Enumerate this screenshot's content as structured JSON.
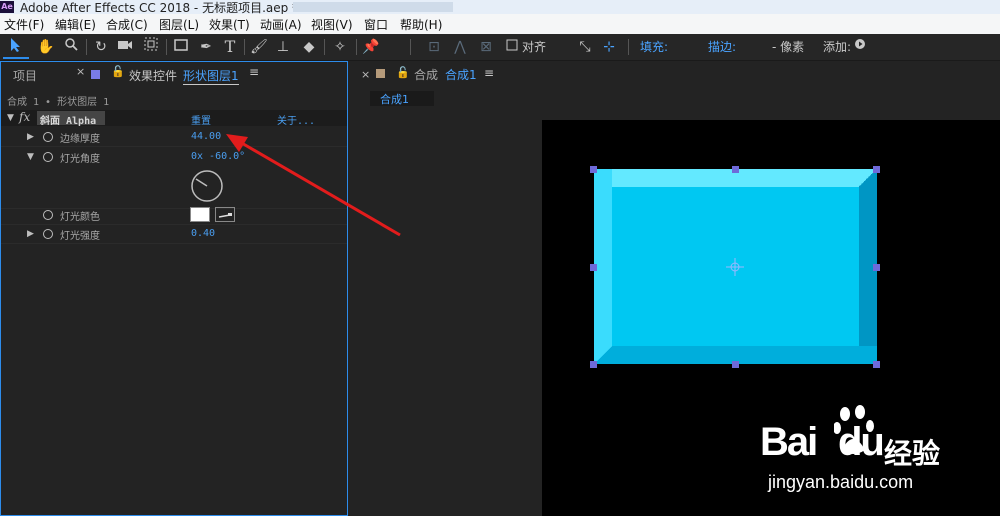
{
  "window": {
    "app_badge": "Ae",
    "title": "Adobe After Effects CC 2018 - 无标题项目.aep *"
  },
  "menu": [
    "文件(F)",
    "编辑(E)",
    "合成(C)",
    "图层(L)",
    "效果(T)",
    "动画(A)",
    "视图(V)",
    "窗口",
    "帮助(H)"
  ],
  "toolbar": {
    "align_label": "对齐",
    "fill_label": "填充:",
    "fill_color": "#00c8f2",
    "stroke_label": "描边:",
    "stroke_value": "- 像素",
    "add_label": "添加:"
  },
  "left_panel": {
    "project_tab": "项目",
    "effects_tab_prefix": "效果控件",
    "effects_tab_layer": "形状图层1",
    "breadcrumb": "合成 1 • 形状图层 1",
    "effect": {
      "fx": "fx",
      "name": "斜面 Alpha",
      "reset": "重置",
      "about": "关于...",
      "props": [
        {
          "label": "边缘厚度",
          "value": "44.00"
        },
        {
          "label": "灯光角度",
          "value": "0x -60.0°"
        },
        {
          "label": "灯光颜色",
          "value": ""
        },
        {
          "label": "灯光强度",
          "value": "0.40"
        }
      ]
    }
  },
  "right_panel": {
    "tab_prefix": "合成",
    "tab_name": "合成1",
    "sub_tab": "合成1"
  },
  "colors": {
    "accent": "#2d8ceb",
    "value_blue": "#4a9ef0",
    "shape_fill": "#00c8f2",
    "arrow_red": "#e21c1c"
  },
  "watermark": {
    "brand": "Bai",
    "brand2": "du",
    "cn": "经验",
    "url": "jingyan.baidu.com"
  }
}
